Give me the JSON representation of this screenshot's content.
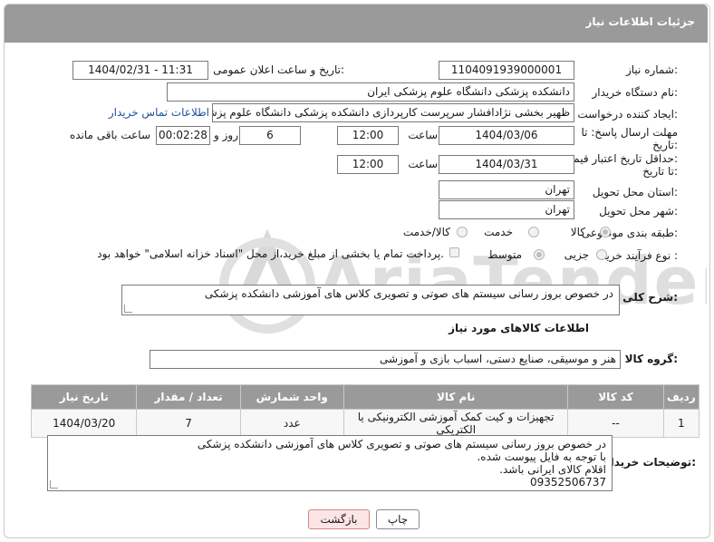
{
  "header": {
    "title": "جزئیات اطلاعات نیاز"
  },
  "form": {
    "need_number_label": "شماره نیاز:",
    "need_number": "1104091939000001",
    "announce_label": "تاریخ و ساعت اعلان عمومی:",
    "announce_value": "1404/02/31 - 11:31",
    "buyer_org_label": "نام دستگاه خریدار:",
    "buyer_org": "دانشکده پزشکی دانشگاه علوم پزشکی ایران",
    "creator_label": "ایجاد کننده درخواست:",
    "creator": "ظهیر بخشی نژادافشار سرپرست کارپردازی دانشکده پزشکی دانشگاه علوم پزشکی",
    "contact_link": "اطلاعات تماس خریدار",
    "deadline_label_1": "مهلت ارسال پاسخ: تا",
    "deadline_label_2": "تاریخ:",
    "deadline_date": "1404/03/06",
    "time_word": "ساعت",
    "deadline_time": "12:00",
    "days_value": "6",
    "days_word": "روز و",
    "remaining_time": "00:02:28",
    "remaining_word": "ساعت باقی مانده",
    "validity_label_1": "حداقل تاریخ اعتبار قیمت:",
    "validity_label_2": "تا تاریخ:",
    "validity_date": "1404/03/31",
    "validity_time": "12:00",
    "province_label": "استان محل تحویل:",
    "province": "تهران",
    "city_label": "شهر محل تحویل:",
    "city": "تهران",
    "category_label": "طبقه بندی موضوعی:",
    "category_options": [
      "کالا",
      "خدمت",
      "کالا/خدمت"
    ],
    "category_selected": "کالا",
    "process_label": "نوع فرآیند خرید :",
    "process_options": [
      "جزیی",
      "متوسط"
    ],
    "payment_note": "پرداخت تمام یا بخشی از مبلغ خرید،از محل \"اسناد خزانه اسلامی\" خواهد بود.",
    "summary_label": "شرح کلی نیاز:",
    "summary": "در خصوص بروز رسانی سیستم های صوتی و تصویری کلاس های آموزشی دانشکده پزشکی"
  },
  "goods": {
    "section_title": "اطلاعات کالاهای مورد نیاز",
    "group_label": "گروه کالا:",
    "group_value": "هنر و موسیقی، صنایع دستی، اسباب بازی و آموزشی",
    "columns": [
      "ردیف",
      "کد کالا",
      "نام کالا",
      "واحد شمارش",
      "تعداد / مقدار",
      "تاریخ نیاز"
    ],
    "rows": [
      [
        "1",
        "--",
        "تجهیزات و کیت کمک آموزشی الکترونیکی یا الکتریکی",
        "عدد",
        "7",
        "1404/03/20"
      ]
    ]
  },
  "notes": {
    "label": "توضیحات خریدار:",
    "lines": [
      "در خصوص بروز رسانی سیستم های صوتی و تصویری کلاس های آموزشی دانشکده پزشکی",
      "با توجه به فایل پیوست شده.",
      "اقلام کالای ایرانی باشد.",
      "09352506737"
    ]
  },
  "buttons": {
    "print": "چاپ",
    "back": "بازگشت"
  },
  "watermark": {
    "text": "AriaTender.net",
    "color": "#d9d9d9"
  }
}
